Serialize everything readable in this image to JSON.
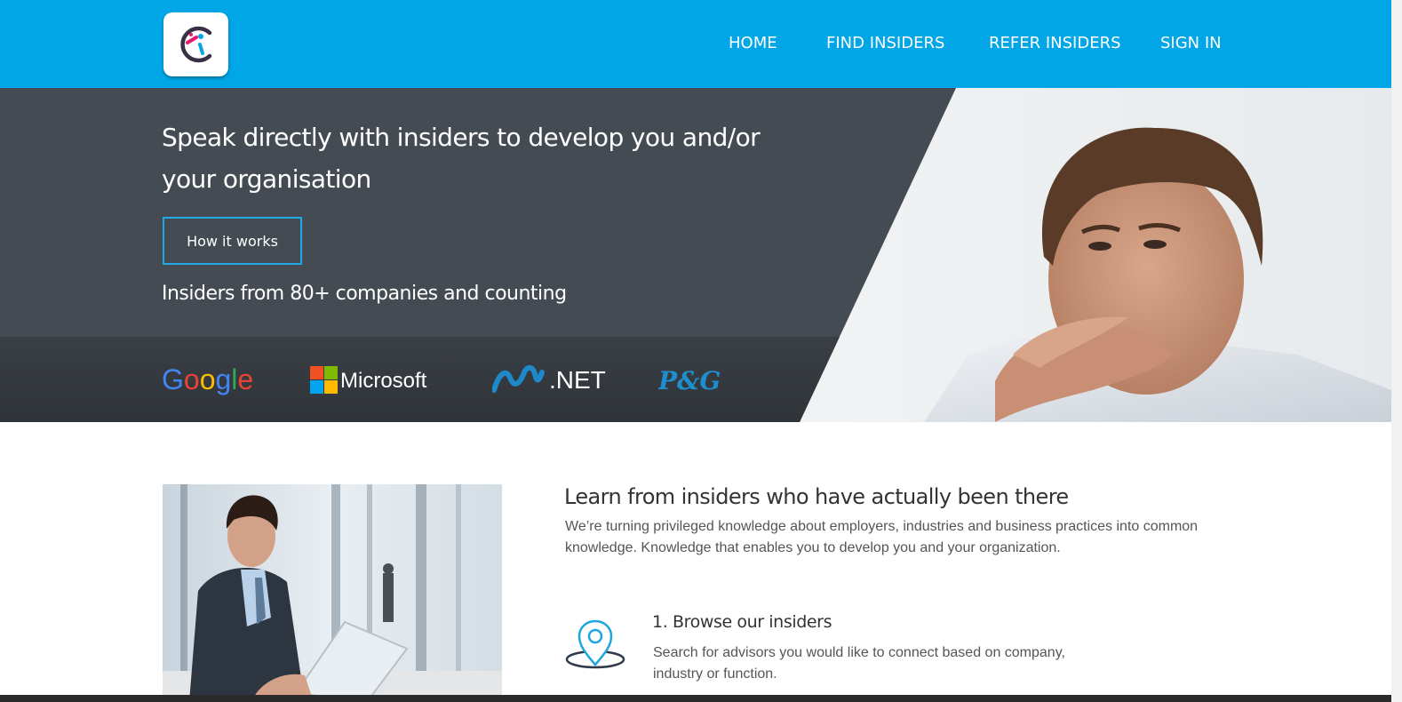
{
  "nav": {
    "items": [
      {
        "label": "HOME"
      },
      {
        "label": "FIND INSIDERS"
      },
      {
        "label": "REFER INSIDERS"
      },
      {
        "label": "SIGN IN"
      }
    ]
  },
  "hero": {
    "title": "Speak directly with insiders to develop you and/or your organisation",
    "button_label": "How it works",
    "subtitle": "Insiders from 80+ companies and counting",
    "companies": [
      {
        "name": "Google"
      },
      {
        "name": "Microsoft"
      },
      {
        "name": ".NET"
      },
      {
        "name": "P&G"
      }
    ]
  },
  "intro": {
    "title": "Learn from insiders who have actually been there",
    "text": "We’re turning privileged knowledge about employers, industries and business practices into common knowledge. Knowledge that enables you to develop you and your organization."
  },
  "steps": [
    {
      "title": "1. Browse our insiders",
      "text": "Search for advisors you would like to connect based on company, industry or function.",
      "icon": "map-pin-icon"
    }
  ],
  "colors": {
    "nav_bg": "#00a6e6",
    "hero_panel": "#454b52",
    "accent": "#20a9e4",
    "google_blue": "#4285f4",
    "google_red": "#ea4335",
    "google_yellow": "#fbbc05",
    "google_green": "#34a853",
    "pg_blue": "#1d8fd0"
  }
}
